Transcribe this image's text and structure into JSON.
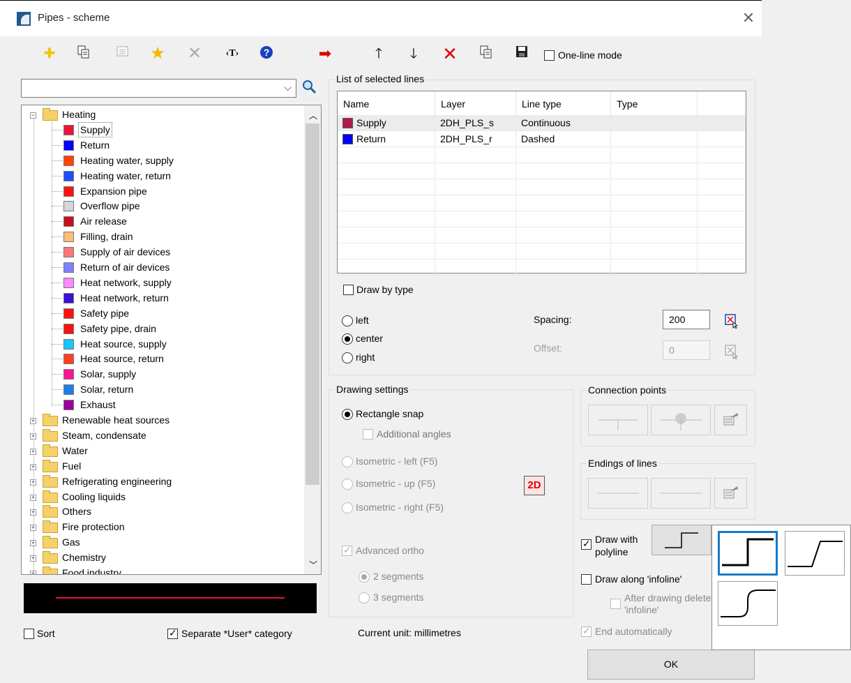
{
  "window": {
    "title": "Pipes - scheme",
    "close_glyph": "✕"
  },
  "toolbar": {
    "one_line_mode_label": "One-line mode",
    "text_tool_label": "‹T›",
    "icons": [
      "add-icon",
      "copy-icon",
      "properties-icon",
      "favorite-star-icon",
      "delete-x-icon",
      "text-icon",
      "help-icon",
      "move-right-arrow-icon",
      "move-up-arrow-icon",
      "move-down-arrow-icon",
      "remove-red-x-icon",
      "copy-icon",
      "save-floppy-icon"
    ]
  },
  "search": {
    "value": ""
  },
  "tree": {
    "heating": {
      "label": "Heating",
      "children": [
        {
          "label": "Supply",
          "color": "#e8143c"
        },
        {
          "label": "Return",
          "color": "#0000ff"
        },
        {
          "label": "Heating water, supply",
          "color": "#ff4500"
        },
        {
          "label": "Heating water, return",
          "color": "#1e4fff"
        },
        {
          "label": "Expansion pipe",
          "color": "#ff1010"
        },
        {
          "label": "Overflow pipe",
          "color": "#d6d6d6"
        },
        {
          "label": "Air release",
          "color": "#c8101a"
        },
        {
          "label": "Filling, drain",
          "color": "#ffbb77"
        },
        {
          "label": "Supply of air devices",
          "color": "#ff7777"
        },
        {
          "label": "Return of air devices",
          "color": "#7f7fff"
        },
        {
          "label": "Heat network, supply",
          "color": "#ff88ff"
        },
        {
          "label": "Heat network, return",
          "color": "#3a10d8"
        },
        {
          "label": "Safety pipe",
          "color": "#ff1010"
        },
        {
          "label": "Safety pipe, drain",
          "color": "#ff1010"
        },
        {
          "label": "Heat source, supply",
          "color": "#14c8ff"
        },
        {
          "label": "Heat source, return",
          "color": "#ff4020"
        },
        {
          "label": "Solar, supply",
          "color": "#ff1493"
        },
        {
          "label": "Solar, return",
          "color": "#1a7fe8"
        },
        {
          "label": "Exhaust",
          "color": "#990099"
        }
      ]
    },
    "categories": [
      "Renewable heat sources",
      "Steam, condensate",
      "Water",
      "Fuel",
      "Refrigerating engineering",
      "Cooling liquids",
      "Others",
      "Fire protection",
      "Gas",
      "Chemistry",
      "Food industry"
    ]
  },
  "preview": {
    "line_color": "#e8143c"
  },
  "bottom": {
    "sort_label": "Sort",
    "separate_label": "Separate *User* category",
    "unit_text": "Current unit: millimetres"
  },
  "selected_lines": {
    "title": "List of selected lines",
    "columns": [
      "Name",
      "Layer",
      "Line type",
      "Type"
    ],
    "rows": [
      {
        "name": "Supply",
        "layer": "2DH_PLS_s",
        "line_type": "Continuous",
        "type": "",
        "color": "#b01a50"
      },
      {
        "name": "Return",
        "layer": "2DH_PLS_r",
        "line_type": "Dashed",
        "type": "",
        "color": "#0000ff"
      }
    ],
    "draw_by_type_label": "Draw by type",
    "align": [
      "left",
      "center",
      "right"
    ],
    "spacing_label": "Spacing:",
    "spacing_value": "200",
    "offset_label": "Offset:",
    "offset_value": "0"
  },
  "drawing_settings": {
    "title": "Drawing settings",
    "rectangle_snap": "Rectangle snap",
    "additional_angles": "Additional angles",
    "iso_left": "Isometric - left (F5)",
    "iso_up": "Isometric - up (F5)",
    "iso_right": "Isometric - right (F5)",
    "mode_badge": "2D",
    "advanced_ortho": "Advanced ortho",
    "two_segments": "2 segments",
    "three_segments": "3 segments"
  },
  "connection_points": {
    "title": "Connection points"
  },
  "endings": {
    "title": "Endings of lines"
  },
  "polyline": {
    "draw_with_polyline": "Draw with polyline",
    "draw_along_infoline": "Draw along 'infoline'",
    "after_drawing_delete": "After drawing delete 'infoline'",
    "end_automatically": "End automatically"
  },
  "ok_label": "OK"
}
